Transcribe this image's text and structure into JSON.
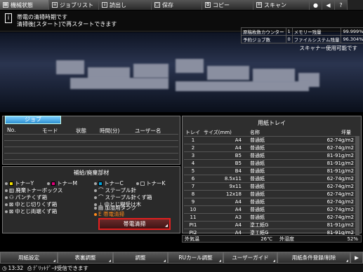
{
  "tabs": [
    {
      "label": "機械状態",
      "icon": "machine-icon",
      "active": true
    },
    {
      "label": "ジョブリスト",
      "icon": "list-icon",
      "active": false
    },
    {
      "label": "読出し",
      "icon": "retrieve-icon",
      "active": false
    },
    {
      "label": "保存",
      "icon": "save-icon",
      "active": false
    },
    {
      "label": "コピー",
      "icon": "copy-icon",
      "active": false
    },
    {
      "label": "スキャン",
      "icon": "scan-icon",
      "active": false
    }
  ],
  "message": {
    "line1": "帯電の清掃時期です",
    "line2": "清掃後[スタート]で再スタートできます"
  },
  "counters": [
    {
      "label": "原稿枚数カウンター",
      "value": "1",
      "label2": "メモリー残量",
      "value2": "99.999%"
    },
    {
      "label": "予約ジョブ数",
      "value": "0",
      "label2": "ファイルシステム残量",
      "value2": "96.304%"
    }
  ],
  "scanner_status": "スキャナー使用可能です",
  "job": {
    "tab": "ジョブ",
    "columns": [
      "No.",
      "モード",
      "状態",
      "時間(分)",
      "ユーザー名"
    ]
  },
  "supplies": {
    "title": "補給/廃棄部材",
    "items": [
      {
        "label": "トナーY",
        "color": "#f2e000"
      },
      {
        "label": "トナーM",
        "color": "#e0007a"
      },
      {
        "label": "トナーC",
        "color": "#00a6e0"
      },
      {
        "label": "トナーK",
        "color": "#222222"
      },
      {
        "label": "廃棄トナーボックス"
      },
      {
        "label": "ステープル針"
      },
      {
        "label": "パンチくず箱"
      },
      {
        "label": "ステープル針くず箱"
      },
      {
        "label": "中とじ切りくず箱"
      },
      {
        "label": "中とじ糊受け木"
      },
      {
        "label": "中とじ両端くず箱"
      },
      {
        "label": "加湿用タンク"
      },
      {
        "label": "E 帯電清掃"
      }
    ],
    "clean_button": "帯電清掃"
  },
  "tray": {
    "title": "用紙トレイ",
    "columns": [
      "トレイ",
      "サイズ(mm)",
      "名称",
      "坪量"
    ],
    "rows": [
      [
        "1",
        "A4",
        "普通紙",
        "62-74g/m2"
      ],
      [
        "2",
        "A4",
        "普通紙",
        "62-74g/m2"
      ],
      [
        "3",
        "B5",
        "普通紙",
        "81-91g/m2"
      ],
      [
        "4",
        "B5",
        "普通紙",
        "81-91g/m2"
      ],
      [
        "5",
        "B4",
        "普通紙",
        "81-91g/m2"
      ],
      [
        "6",
        "8.5x11",
        "普通紙",
        "62-74g/m2"
      ],
      [
        "7",
        "9x11",
        "普通紙",
        "62-74g/m2"
      ],
      [
        "8",
        "12x18",
        "普通紙",
        "62-74g/m2"
      ],
      [
        "9",
        "A4",
        "普通紙",
        "62-74g/m2"
      ],
      [
        "10",
        "A4",
        "普通紙",
        "62-74g/m2"
      ],
      [
        "11",
        "A3",
        "普通紙",
        "62-74g/m2"
      ],
      [
        "PI1",
        "A4",
        "塗工紙G",
        "81-91g/m2"
      ],
      [
        "PI2",
        "A4",
        "塗工紙G",
        "81-91g/m2"
      ]
    ]
  },
  "environment": {
    "temp_label": "外気温",
    "temp_value": "26℃",
    "humidity_label": "外湿度",
    "humidity_value": "52%"
  },
  "bottom_buttons": [
    "用紙設定",
    "表裏調整",
    "調整",
    "RUカール調整",
    "ユーザーガイド",
    "用紙条件登録/削除"
  ],
  "status": {
    "time": "13:32",
    "text": "ﾃﾞﾘｯﾄﾃﾞｰﾀ受信できます"
  }
}
